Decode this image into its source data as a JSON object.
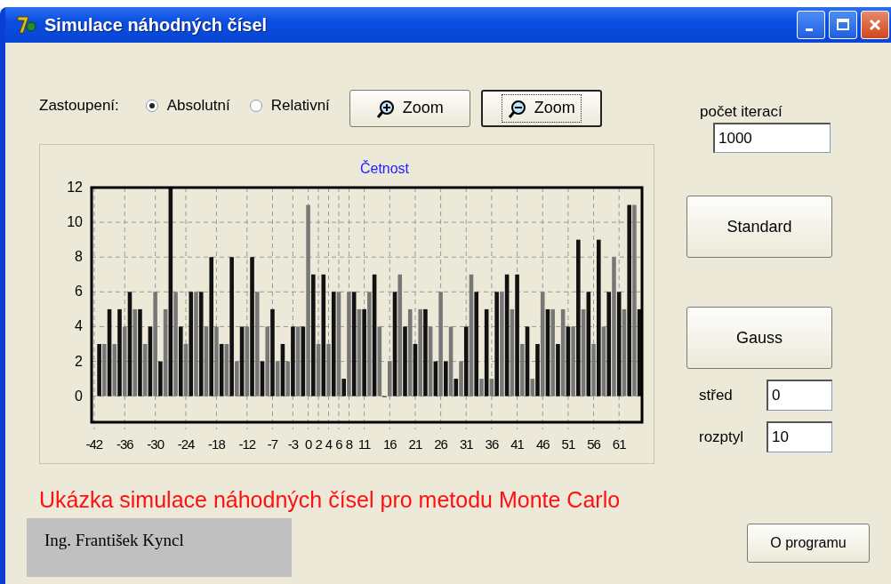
{
  "window": {
    "title": "Simulace náhodných čísel"
  },
  "representation": {
    "label": "Zastoupení:",
    "options": [
      {
        "label": "Absolutní",
        "selected": true
      },
      {
        "label": "Relativní",
        "selected": false
      }
    ]
  },
  "zoom_buttons": [
    {
      "label": "Zoom",
      "kind": "zoom-in",
      "focused": false
    },
    {
      "label": "Zoom",
      "kind": "zoom-out",
      "focused": true
    }
  ],
  "iterations": {
    "label": "počet iterací",
    "value": "1000"
  },
  "action_buttons": [
    "Standard",
    "Gauss"
  ],
  "params": [
    {
      "label": "střed",
      "value": "0"
    },
    {
      "label": "rozptyl",
      "value": "10"
    }
  ],
  "chart": {
    "chart_data": {
      "type": "bar",
      "title": "Četnost",
      "grid": true,
      "xlim": [
        -42.5,
        65.5
      ],
      "ylim": [
        -1.5,
        12
      ],
      "yticks": [
        0,
        2,
        4,
        6,
        8,
        10,
        12
      ],
      "xticks": [
        -42,
        -36,
        -30,
        -24,
        -18,
        -12,
        -7,
        -3,
        0,
        2,
        4,
        6,
        8,
        11,
        16,
        21,
        26,
        31,
        36,
        41,
        46,
        51,
        56,
        61
      ],
      "x": [
        -41,
        -40,
        -39,
        -38,
        -37,
        -36,
        -35,
        -34,
        -33,
        -32,
        -31,
        -30,
        -29,
        -28,
        -27,
        -26,
        -25,
        -24,
        -23,
        -22,
        -21,
        -20,
        -19,
        -18,
        -17,
        -16,
        -15,
        -14,
        -13,
        -12,
        -11,
        -10,
        -9,
        -8,
        -7,
        -6,
        -5,
        -4,
        -3,
        -2,
        -1,
        0,
        1,
        2,
        3,
        4,
        5,
        6,
        7,
        8,
        9,
        10,
        11,
        12,
        13,
        14,
        15,
        16,
        17,
        18,
        19,
        20,
        21,
        22,
        23,
        24,
        25,
        26,
        27,
        28,
        29,
        30,
        31,
        32,
        33,
        34,
        35,
        36,
        37,
        38,
        39,
        40,
        41,
        42,
        43,
        44,
        45,
        46,
        47,
        48,
        49,
        50,
        51,
        52,
        53,
        54,
        55,
        56,
        57,
        58,
        59,
        60,
        61,
        62,
        63,
        64,
        65
      ],
      "values": [
        3,
        3,
        5,
        3,
        5,
        4,
        6,
        5,
        5,
        3,
        4,
        6,
        2,
        5,
        12,
        6,
        4,
        3,
        6,
        6,
        6,
        4,
        8,
        4,
        3,
        3,
        8,
        2,
        4,
        4,
        8,
        6,
        2,
        4,
        5,
        2,
        3,
        2,
        4,
        4,
        4,
        11,
        7,
        3,
        7,
        3,
        6,
        6,
        1,
        6,
        6,
        5,
        5,
        6,
        7,
        4,
        0,
        2,
        6,
        7,
        4,
        5,
        3,
        5,
        5,
        4,
        2,
        6,
        2,
        4,
        1,
        2,
        4,
        7,
        6,
        1,
        5,
        1,
        6,
        6,
        7,
        5,
        7,
        3,
        4,
        1,
        3,
        6,
        5,
        5,
        3,
        5,
        4,
        4,
        9,
        5,
        6,
        3,
        9,
        4,
        6,
        8,
        6,
        5,
        11,
        11,
        5
      ]
    }
  },
  "caption": "Ukázka simulace náhodných čísel pro metodu Monte Carlo",
  "author": "Ing. František Kyncl",
  "about_button": "O programu"
}
